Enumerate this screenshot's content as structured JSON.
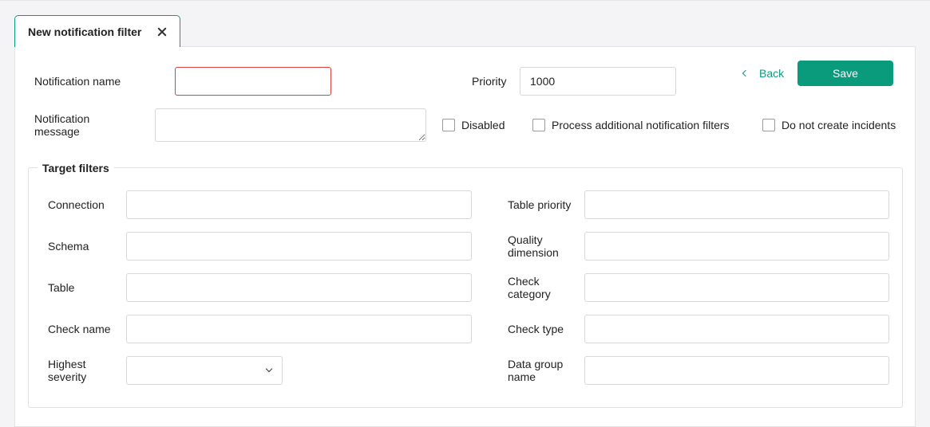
{
  "tab": {
    "title": "New notification filter"
  },
  "form": {
    "notification_name_label": "Notification name",
    "notification_name_value": "",
    "priority_label": "Priority",
    "priority_value": "1000",
    "notification_message_label_1": "Notification",
    "notification_message_label_2": "message",
    "notification_message_value": "",
    "disabled_label": "Disabled",
    "process_additional_label": "Process additional notification filters",
    "do_not_create_label": "Do not create incidents"
  },
  "actions": {
    "back_label": "Back",
    "save_label": "Save"
  },
  "target_filters": {
    "legend": "Target filters",
    "connection_label": "Connection",
    "schema_label": "Schema",
    "table_label": "Table",
    "check_name_label": "Check name",
    "highest_severity_label_1": "Highest",
    "highest_severity_label_2": "severity",
    "highest_severity_value": "",
    "table_priority_label": "Table priority",
    "quality_dimension_label_1": "Quality",
    "quality_dimension_label_2": "dimension",
    "check_category_label_1": "Check",
    "check_category_label_2": "category",
    "check_type_label": "Check type",
    "data_group_label_1": "Data group",
    "data_group_label_2": "name"
  },
  "colors": {
    "accent": "#0a9b7d",
    "error": "#d9413a"
  }
}
